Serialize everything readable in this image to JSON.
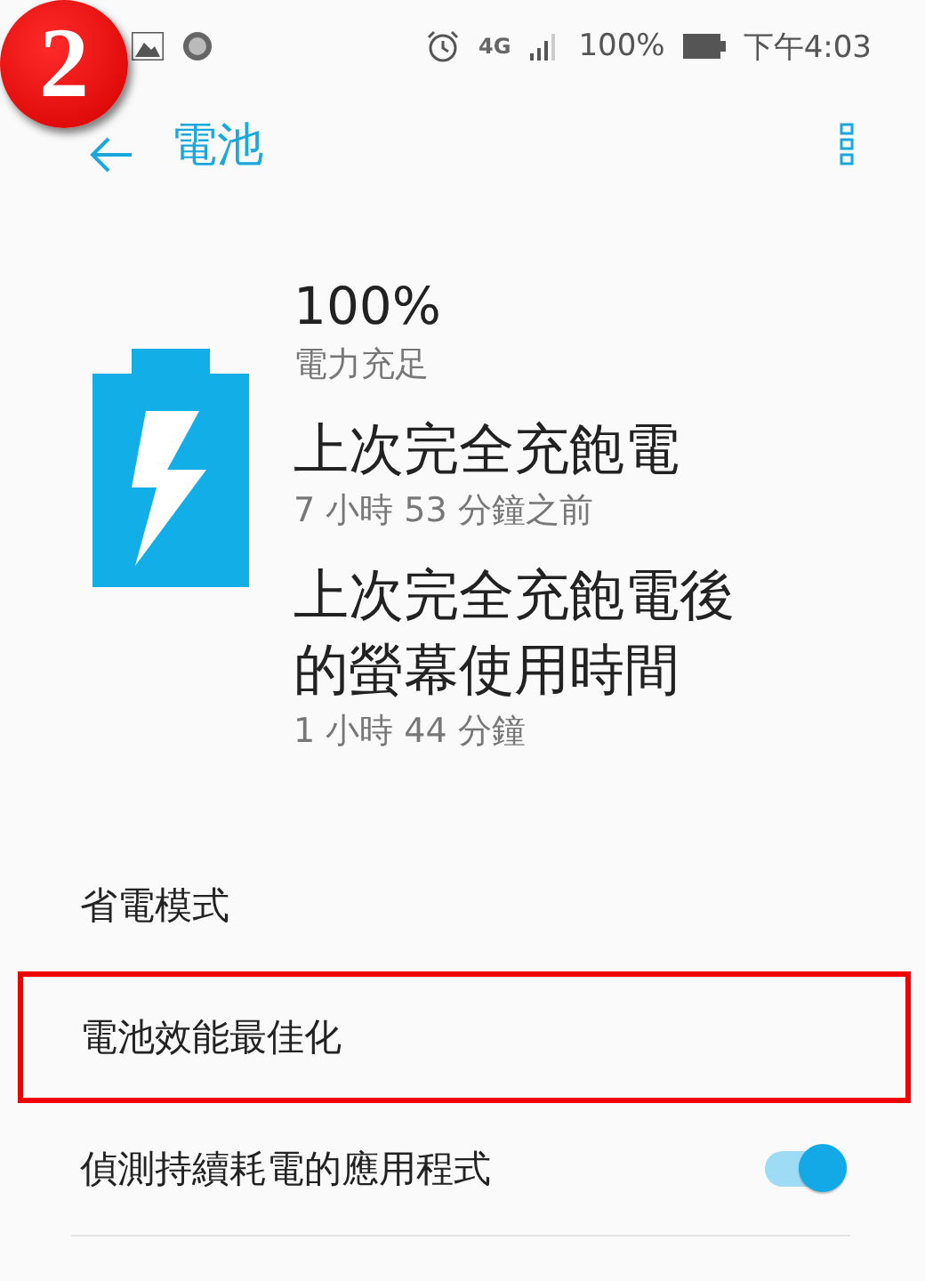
{
  "annotation": {
    "number": "2"
  },
  "status_bar": {
    "network": "4G",
    "battery": "100%",
    "time": "下午4:03"
  },
  "app_bar": {
    "title": "電池"
  },
  "summary": {
    "percent": "100%",
    "status": "電力充足",
    "stats": [
      {
        "heading": "上次完全充飽電",
        "value": "7 小時 53 分鐘之前"
      },
      {
        "heading": "上次完全充飽電後的螢幕使用時間",
        "value": "1 小時 44 分鐘"
      }
    ]
  },
  "settings": [
    {
      "kind": "link",
      "label": "省電模式",
      "highlighted": false
    },
    {
      "kind": "link",
      "label": "電池效能最佳化",
      "highlighted": true
    },
    {
      "kind": "toggle",
      "label": "偵測持續耗電的應用程式",
      "highlighted": false,
      "on": true
    }
  ]
}
